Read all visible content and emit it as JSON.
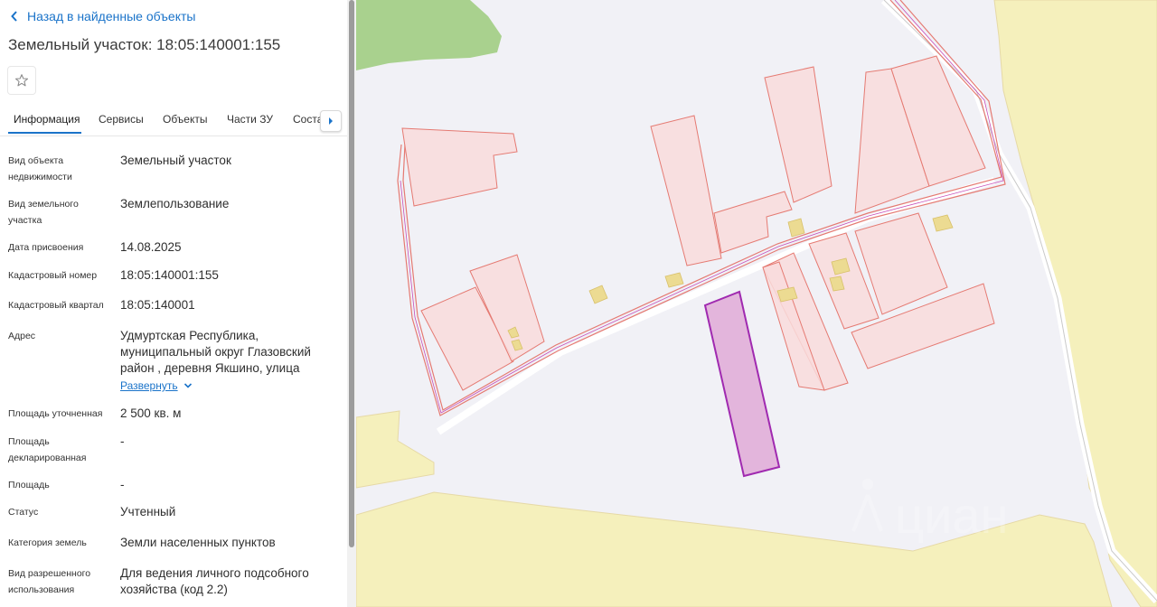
{
  "back_link": "Назад в найденные объекты",
  "title": "Земельный участок: 18:05:140001:155",
  "tabs": [
    {
      "label": "Информация",
      "active": true
    },
    {
      "label": "Сервисы"
    },
    {
      "label": "Объекты"
    },
    {
      "label": "Части ЗУ"
    },
    {
      "label": "Соста"
    }
  ],
  "fields": [
    {
      "label": "Вид объекта недвижимости",
      "value": "Земельный участок"
    },
    {
      "label": "Вид земельного участка",
      "value": "Землепользование"
    },
    {
      "label": "Дата присвоения",
      "value": "14.08.2025"
    },
    {
      "label": "Кадастровый номер",
      "value": "18:05:140001:155"
    },
    {
      "label": "Кадастровый квартал",
      "value": "18:05:140001"
    },
    {
      "label": "Адрес",
      "value": "Удмуртская Республика, муниципальный округ Глазовский район , деревня Якшино, улица",
      "expand_label": "Развернуть"
    },
    {
      "label": "Площадь уточненная",
      "value": "2 500 кв. м"
    },
    {
      "label": "Площадь декларированная",
      "value": "-"
    },
    {
      "label": "Площадь",
      "value": "-"
    },
    {
      "label": "Статус",
      "value": "Учтенный"
    },
    {
      "label": "Категория земель",
      "value": "Земли населенных пунктов"
    },
    {
      "label": "Вид разрешенного использования",
      "value": "Для ведения личного подсобного хозяйства (код 2.2)"
    }
  ],
  "map": {
    "watermark": "циан",
    "colors": {
      "background": "#f1f1f6",
      "parcel_fill": "#f9dcdc",
      "parcel_stroke": "#e57a72",
      "selected_fill": "#e3b5dc",
      "selected_stroke": "#a02ab0",
      "field": "#f5f0bc",
      "forest": "#a9d18e",
      "building": "#ecdb92"
    }
  }
}
